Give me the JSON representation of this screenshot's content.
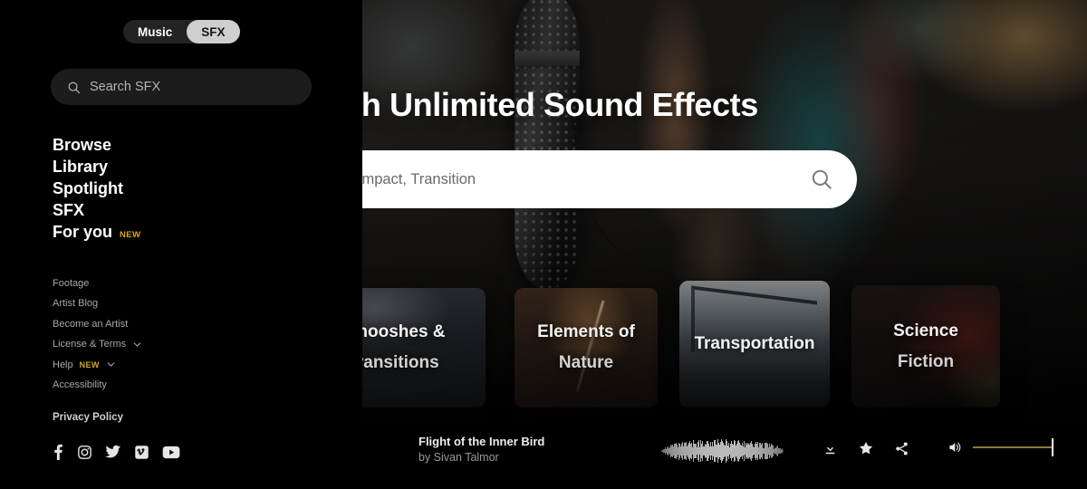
{
  "hero": {
    "title": "arch Unlimited Sound Effects",
    "search_placeholder": ": Whoosh, Impact, Transition",
    "search_icon": "search-icon"
  },
  "cards": [
    {
      "line1": "Whooshes &",
      "line2": "Transitions"
    },
    {
      "line1": "Elements of",
      "line2": "Nature"
    },
    {
      "line1": "Transportation",
      "line2": ""
    },
    {
      "line1": "Science",
      "line2": "Fiction"
    }
  ],
  "player": {
    "track_title": "Flight of the Inner Bird",
    "track_artist": "by Sivan Talmor",
    "download_icon": "download-icon",
    "favorite_icon": "star-icon",
    "share_icon": "share-icon",
    "volume_icon": "volume-icon",
    "volume_level": 100,
    "volume_color": "#8f7a33"
  },
  "sidebar": {
    "segmented": {
      "options": [
        "Music",
        "SFX"
      ],
      "selected": "SFX"
    },
    "search": {
      "placeholder": "Search SFX",
      "icon": "search-icon"
    },
    "nav": [
      {
        "label": "Browse",
        "badge": ""
      },
      {
        "label": "Library",
        "badge": ""
      },
      {
        "label": "Spotlight",
        "badge": ""
      },
      {
        "label": "SFX",
        "badge": ""
      },
      {
        "label": "For you",
        "badge": "NEW"
      }
    ],
    "sub_links": [
      {
        "label": "Footage",
        "badge": "",
        "chevron": false
      },
      {
        "label": "Artist Blog",
        "badge": "",
        "chevron": false
      },
      {
        "label": "Become an Artist",
        "badge": "",
        "chevron": false
      },
      {
        "label": "License & Terms",
        "badge": "",
        "chevron": true
      },
      {
        "label": "Help",
        "badge": "NEW",
        "chevron": true
      },
      {
        "label": "Accessibility",
        "badge": "",
        "chevron": false
      }
    ],
    "privacy_label": "Privacy Policy",
    "social": [
      "facebook-icon",
      "instagram-icon",
      "twitter-icon",
      "vimeo-icon",
      "youtube-icon"
    ]
  },
  "colors": {
    "accent_new": "#d8a72b",
    "sidebar_bg": "#000000",
    "search_pill": "#1c1c1c"
  }
}
